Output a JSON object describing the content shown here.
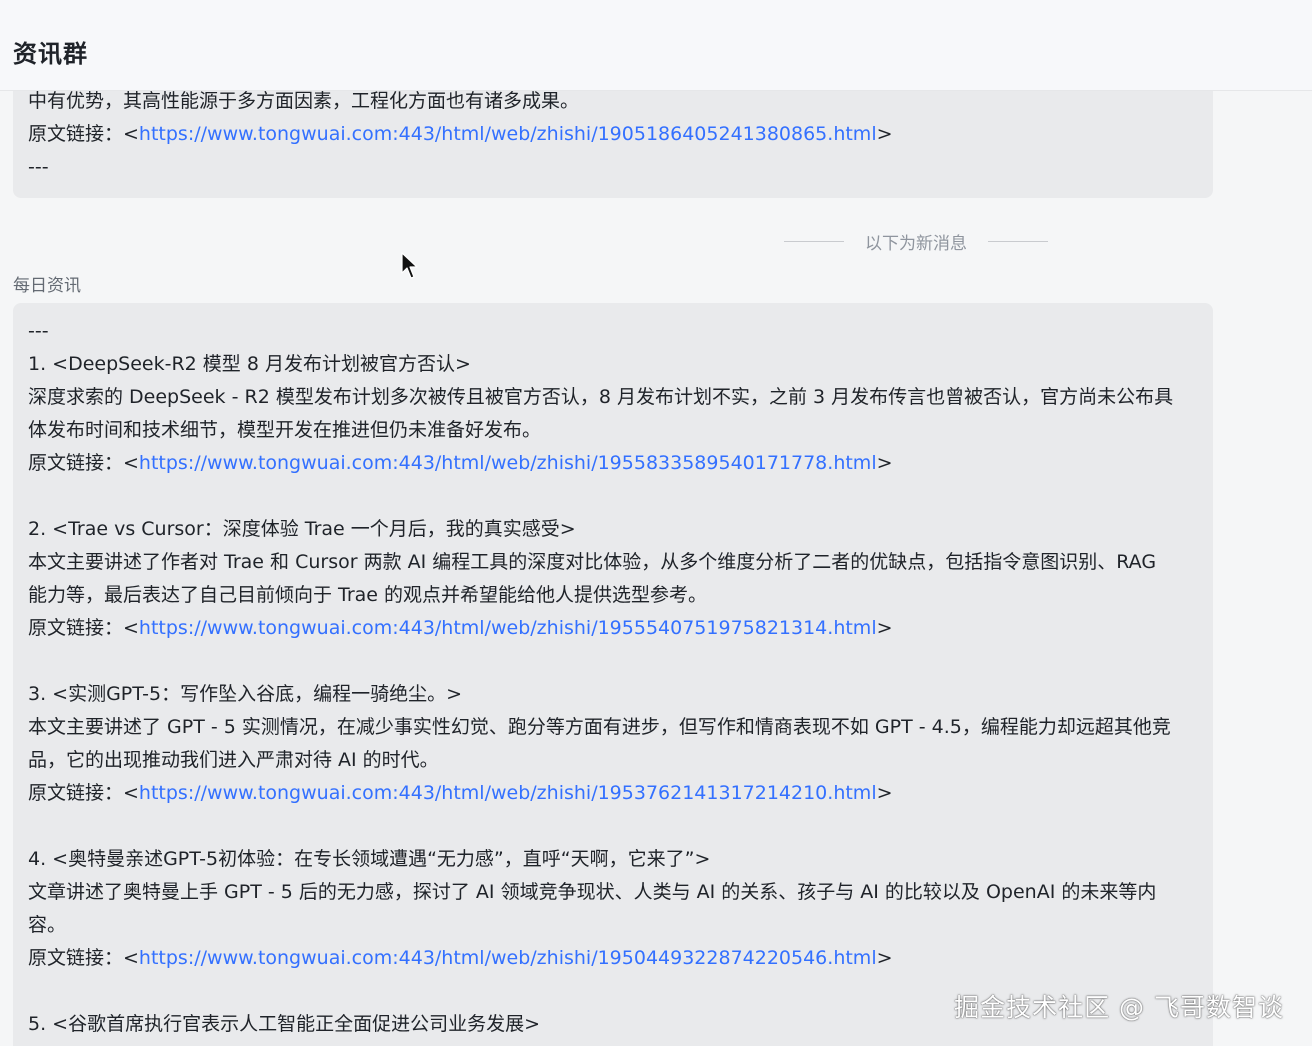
{
  "header": {
    "title": "资讯群"
  },
  "previous_message": {
    "lines": [
      "中有优势，其高性能源于多方面因素，工程化方面也有诸多成果。"
    ],
    "link_prefix": "原文链接：<",
    "link": "https://www.tongwuai.com:443/html/web/zhishi/1905186405241380865.html",
    "link_suffix": ">",
    "separator": "---"
  },
  "divider": {
    "label": "以下为新消息"
  },
  "message": {
    "sender": "每日资讯",
    "separator": "---",
    "items": [
      {
        "title": "1. <DeepSeek-R2 模型 8 月发布计划被官方否认>",
        "lines": [
          "深度求索的 DeepSeek - R2 模型发布计划多次被传且被官方否认，8 月发布计划不实，之前 3 月发布传言也曾被否认，官方尚未公布具",
          "体发布时间和技术细节，模型开发在推进但仍未准备好发布。"
        ],
        "link_prefix": "原文链接：<",
        "link": "https://www.tongwuai.com:443/html/web/zhishi/1955833589540171778.html",
        "link_suffix": ">"
      },
      {
        "title": "2. <Trae vs Cursor：深度体验 Trae 一个月后，我的真实感受>",
        "lines": [
          "本文主要讲述了作者对 Trae 和 Cursor 两款 AI 编程工具的深度对比体验，从多个维度分析了二者的优缺点，包括指令意图识别、RAG",
          "能力等，最后表达了自己目前倾向于 Trae 的观点并希望能给他人提供选型参考。"
        ],
        "link_prefix": "原文链接：<",
        "link": "https://www.tongwuai.com:443/html/web/zhishi/1955540751975821314.html",
        "link_suffix": ">"
      },
      {
        "title": "3. <实测GPT-5：写作坠入谷底，编程一骑绝尘。>",
        "lines": [
          "本文主要讲述了 GPT - 5 实测情况，在减少事实性幻觉、跑分等方面有进步，但写作和情商表现不如 GPT - 4.5，编程能力却远超其他竞",
          "品，它的出现推动我们进入严肃对待 AI 的时代。"
        ],
        "link_prefix": "原文链接：<",
        "link": "https://www.tongwuai.com:443/html/web/zhishi/1953762141317214210.html",
        "link_suffix": ">"
      },
      {
        "title": "4. <奥特曼亲述GPT-5初体验：在专长领域遭遇“无力感”，直呼“天啊，它来了”>",
        "lines": [
          "文章讲述了奥特曼上手 GPT - 5 后的无力感，探讨了 AI 领域竞争现状、人类与 AI 的关系、孩子与 AI 的比较以及 OpenAI 的未来等内",
          "容。"
        ],
        "link_prefix": "原文链接：<",
        "link": "https://www.tongwuai.com:443/html/web/zhishi/1950449322874220546.html",
        "link_suffix": ">"
      },
      {
        "title": "5. <谷歌首席执行官表示人工智能正全面促进公司业务发展>",
        "lines": [],
        "link_prefix": "",
        "link": "",
        "link_suffix": ""
      }
    ]
  },
  "watermark": "掘金技术社区 @ 飞哥数智谈",
  "colors": {
    "link": "#3370ff",
    "bubble": "#e9eaec",
    "background": "#f5f6f7"
  }
}
